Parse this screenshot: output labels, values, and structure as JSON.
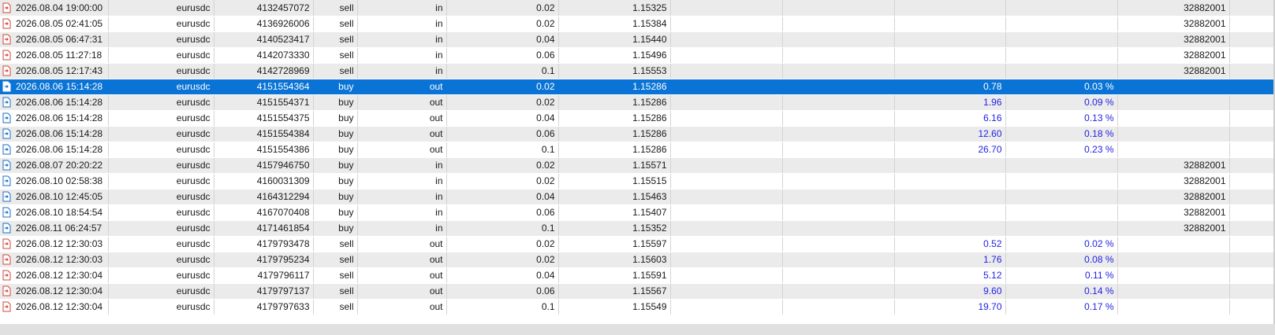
{
  "colors": {
    "sell_icon": "#d6453a",
    "buy_icon": "#1a6fc9",
    "selected_row": "#0a74d6",
    "profit_text": "#1f1fe6"
  },
  "rows": [
    {
      "time": "2026.08.04 19:00:00",
      "symbol": "eurusdc",
      "deal": "4132457072",
      "type": "sell",
      "dir": "in",
      "volume": "0.02",
      "price": "1.15325",
      "profit": "",
      "pct": "",
      "id": "32882001",
      "icon": "sell-deal-icon",
      "selected": false
    },
    {
      "time": "2026.08.05 02:41:05",
      "symbol": "eurusdc",
      "deal": "4136926006",
      "type": "sell",
      "dir": "in",
      "volume": "0.02",
      "price": "1.15384",
      "profit": "",
      "pct": "",
      "id": "32882001",
      "icon": "sell-deal-icon",
      "selected": false
    },
    {
      "time": "2026.08.05 06:47:31",
      "symbol": "eurusdc",
      "deal": "4140523417",
      "type": "sell",
      "dir": "in",
      "volume": "0.04",
      "price": "1.15440",
      "profit": "",
      "pct": "",
      "id": "32882001",
      "icon": "sell-deal-icon",
      "selected": false
    },
    {
      "time": "2026.08.05 11:27:18",
      "symbol": "eurusdc",
      "deal": "4142073330",
      "type": "sell",
      "dir": "in",
      "volume": "0.06",
      "price": "1.15496",
      "profit": "",
      "pct": "",
      "id": "32882001",
      "icon": "sell-deal-icon",
      "selected": false
    },
    {
      "time": "2026.08.05 12:17:43",
      "symbol": "eurusdc",
      "deal": "4142728969",
      "type": "sell",
      "dir": "in",
      "volume": "0.1",
      "price": "1.15553",
      "profit": "",
      "pct": "",
      "id": "32882001",
      "icon": "sell-deal-icon",
      "selected": false
    },
    {
      "time": "2026.08.06 15:14:28",
      "symbol": "eurusdc",
      "deal": "4151554364",
      "type": "buy",
      "dir": "out",
      "volume": "0.02",
      "price": "1.15286",
      "profit": "0.78",
      "pct": "0.03 %",
      "id": "",
      "icon": "buy-deal-icon",
      "selected": true
    },
    {
      "time": "2026.08.06 15:14:28",
      "symbol": "eurusdc",
      "deal": "4151554371",
      "type": "buy",
      "dir": "out",
      "volume": "0.02",
      "price": "1.15286",
      "profit": "1.96",
      "pct": "0.09 %",
      "id": "",
      "icon": "buy-deal-icon",
      "selected": false
    },
    {
      "time": "2026.08.06 15:14:28",
      "symbol": "eurusdc",
      "deal": "4151554375",
      "type": "buy",
      "dir": "out",
      "volume": "0.04",
      "price": "1.15286",
      "profit": "6.16",
      "pct": "0.13 %",
      "id": "",
      "icon": "buy-deal-icon",
      "selected": false
    },
    {
      "time": "2026.08.06 15:14:28",
      "symbol": "eurusdc",
      "deal": "4151554384",
      "type": "buy",
      "dir": "out",
      "volume": "0.06",
      "price": "1.15286",
      "profit": "12.60",
      "pct": "0.18 %",
      "id": "",
      "icon": "buy-deal-icon",
      "selected": false
    },
    {
      "time": "2026.08.06 15:14:28",
      "symbol": "eurusdc",
      "deal": "4151554386",
      "type": "buy",
      "dir": "out",
      "volume": "0.1",
      "price": "1.15286",
      "profit": "26.70",
      "pct": "0.23 %",
      "id": "",
      "icon": "buy-deal-icon",
      "selected": false
    },
    {
      "time": "2026.08.07 20:20:22",
      "symbol": "eurusdc",
      "deal": "4157946750",
      "type": "buy",
      "dir": "in",
      "volume": "0.02",
      "price": "1.15571",
      "profit": "",
      "pct": "",
      "id": "32882001",
      "icon": "buy-deal-icon",
      "selected": false
    },
    {
      "time": "2026.08.10 02:58:38",
      "symbol": "eurusdc",
      "deal": "4160031309",
      "type": "buy",
      "dir": "in",
      "volume": "0.02",
      "price": "1.15515",
      "profit": "",
      "pct": "",
      "id": "32882001",
      "icon": "buy-deal-icon",
      "selected": false
    },
    {
      "time": "2026.08.10 12:45:05",
      "symbol": "eurusdc",
      "deal": "4164312294",
      "type": "buy",
      "dir": "in",
      "volume": "0.04",
      "price": "1.15463",
      "profit": "",
      "pct": "",
      "id": "32882001",
      "icon": "buy-deal-icon",
      "selected": false
    },
    {
      "time": "2026.08.10 18:54:54",
      "symbol": "eurusdc",
      "deal": "4167070408",
      "type": "buy",
      "dir": "in",
      "volume": "0.06",
      "price": "1.15407",
      "profit": "",
      "pct": "",
      "id": "32882001",
      "icon": "buy-deal-icon",
      "selected": false
    },
    {
      "time": "2026.08.11 06:24:57",
      "symbol": "eurusdc",
      "deal": "4171461854",
      "type": "buy",
      "dir": "in",
      "volume": "0.1",
      "price": "1.15352",
      "profit": "",
      "pct": "",
      "id": "32882001",
      "icon": "buy-deal-icon",
      "selected": false
    },
    {
      "time": "2026.08.12 12:30:03",
      "symbol": "eurusdc",
      "deal": "4179793478",
      "type": "sell",
      "dir": "out",
      "volume": "0.02",
      "price": "1.15597",
      "profit": "0.52",
      "pct": "0.02 %",
      "id": "",
      "icon": "sell-deal-icon",
      "selected": false
    },
    {
      "time": "2026.08.12 12:30:03",
      "symbol": "eurusdc",
      "deal": "4179795234",
      "type": "sell",
      "dir": "out",
      "volume": "0.02",
      "price": "1.15603",
      "profit": "1.76",
      "pct": "0.08 %",
      "id": "",
      "icon": "sell-deal-icon",
      "selected": false
    },
    {
      "time": "2026.08.12 12:30:04",
      "symbol": "eurusdc",
      "deal": "4179796117",
      "type": "sell",
      "dir": "out",
      "volume": "0.04",
      "price": "1.15591",
      "profit": "5.12",
      "pct": "0.11 %",
      "id": "",
      "icon": "sell-deal-icon",
      "selected": false
    },
    {
      "time": "2026.08.12 12:30:04",
      "symbol": "eurusdc",
      "deal": "4179797137",
      "type": "sell",
      "dir": "out",
      "volume": "0.06",
      "price": "1.15567",
      "profit": "9.60",
      "pct": "0.14 %",
      "id": "",
      "icon": "sell-deal-icon",
      "selected": false
    },
    {
      "time": "2026.08.12 12:30:04",
      "symbol": "eurusdc",
      "deal": "4179797633",
      "type": "sell",
      "dir": "out",
      "volume": "0.1",
      "price": "1.15549",
      "profit": "19.70",
      "pct": "0.17 %",
      "id": "",
      "icon": "sell-deal-icon",
      "selected": false
    }
  ]
}
